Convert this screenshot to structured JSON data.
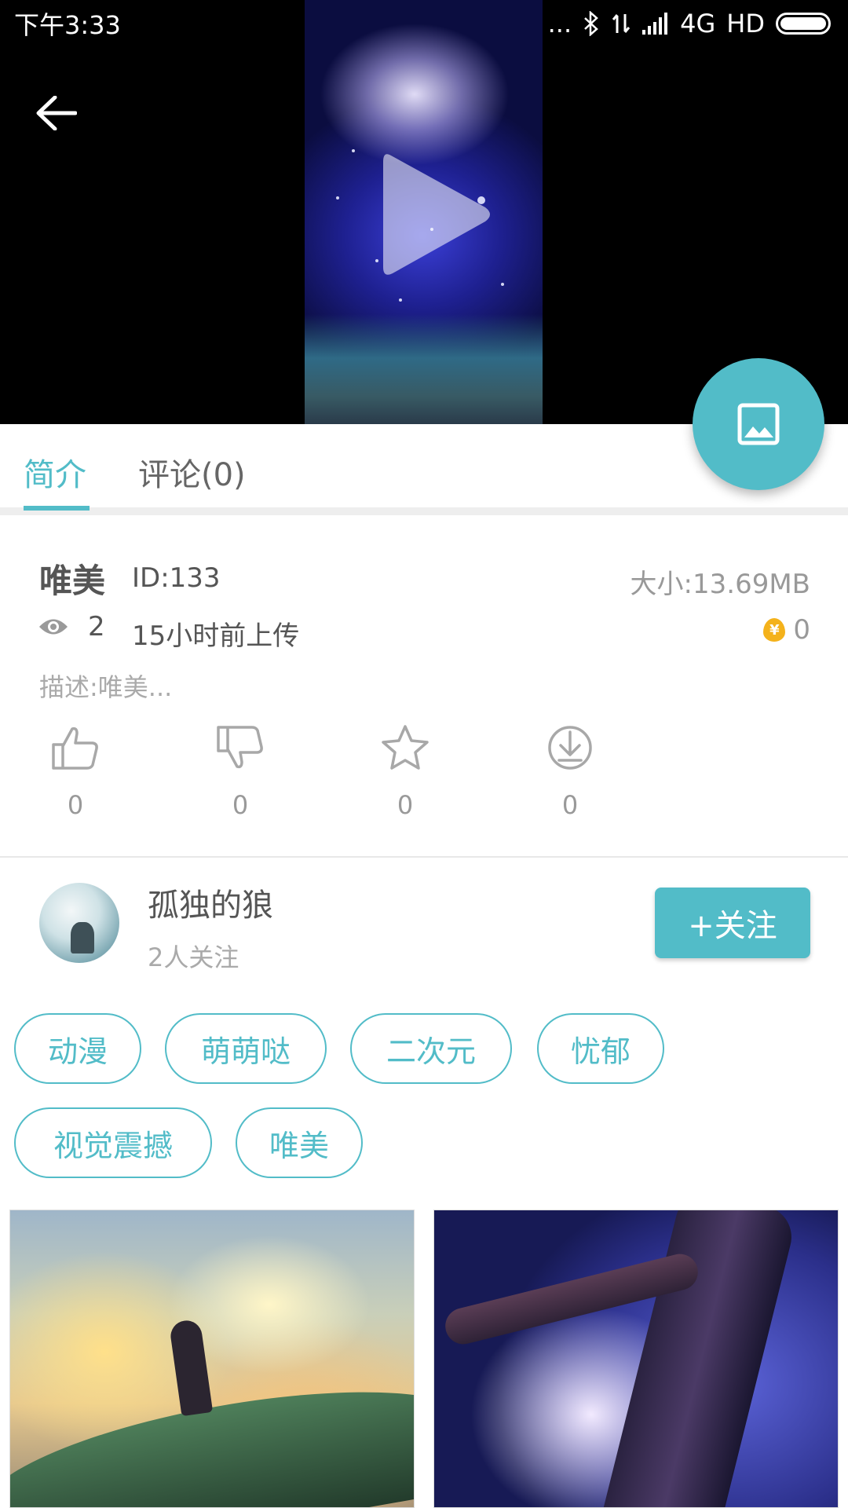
{
  "status_bar": {
    "time": "下午3:33",
    "dots": "...",
    "network": "4G",
    "hd": "HD"
  },
  "video": {
    "background_color": "#000000"
  },
  "tabs": [
    {
      "label": "简介",
      "active": true
    },
    {
      "label": "评论(0)",
      "active": false
    }
  ],
  "info": {
    "title": "唯美",
    "id": "ID:133",
    "size": "大小:13.69MB",
    "views": "2",
    "upload_time": "15小时前上传",
    "coin_symbol": "¥",
    "coins": "0",
    "description": "描述:唯美..."
  },
  "actions": [
    {
      "name": "like",
      "icon": "thumbs-up-icon",
      "count": "0"
    },
    {
      "name": "dislike",
      "icon": "thumbs-down-icon",
      "count": "0"
    },
    {
      "name": "favorite",
      "icon": "star-icon",
      "count": "0"
    },
    {
      "name": "download",
      "icon": "download-icon",
      "count": "0"
    }
  ],
  "author": {
    "name": "孤独的狼",
    "followers": "2人关注",
    "follow_label": "+关注"
  },
  "tags": [
    "动漫",
    "萌萌哒",
    "二次元",
    "忧郁",
    "视觉震撼",
    "唯美"
  ],
  "colors": {
    "accent": "#52bcc8",
    "coin": "#f4b21b"
  }
}
